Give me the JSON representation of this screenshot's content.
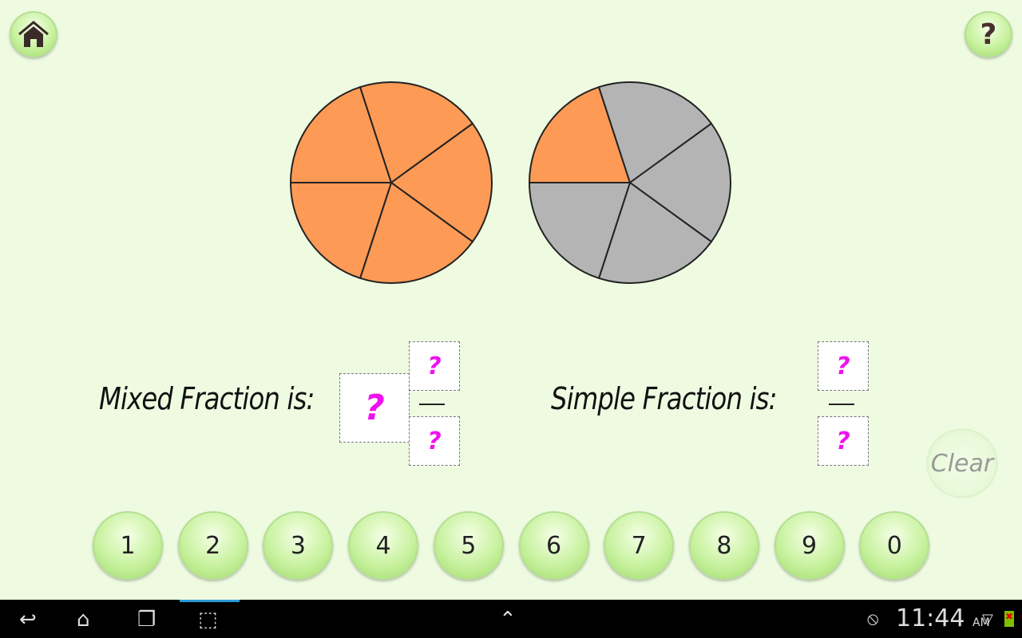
{
  "toolbar": {
    "home_icon": "home-icon",
    "help_label": "?"
  },
  "pies": [
    {
      "slices": 5,
      "filled": 5,
      "filled_color": "#fd9a55",
      "empty_color": "#b4b4b4"
    },
    {
      "slices": 5,
      "filled": 1,
      "filled_color": "#fd9a55",
      "empty_color": "#b4b4b4"
    }
  ],
  "mixed": {
    "label": "Mixed Fraction is:",
    "whole": "?",
    "numerator": "?",
    "denominator": "?"
  },
  "simple": {
    "label": "Simple Fraction is:",
    "numerator": "?",
    "denominator": "?"
  },
  "clear_label": "Clear",
  "keypad": [
    "1",
    "2",
    "3",
    "4",
    "5",
    "6",
    "7",
    "8",
    "9",
    "0"
  ],
  "statusbar": {
    "time": "11:44",
    "ampm": "AM"
  }
}
